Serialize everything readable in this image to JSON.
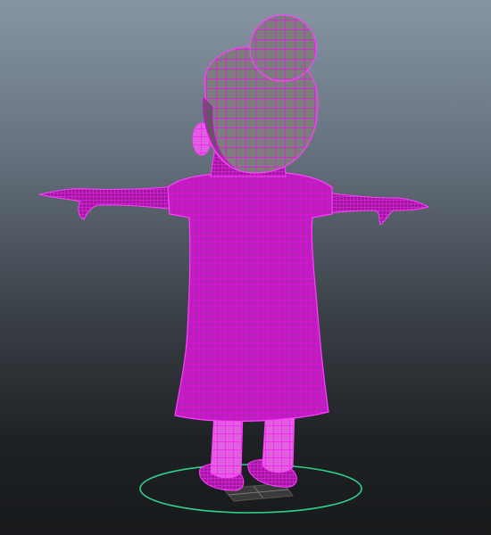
{
  "viewport": {
    "background_top": "#8795a3",
    "background_bottom": "#17191b"
  },
  "model": {
    "description_icon": "character-mesh-icon",
    "shaded_color": "#828282",
    "shaded_dark": "#5a5a5a",
    "wireframe_color": "#ff00ff",
    "pose": "T-pose",
    "view": "back"
  },
  "manipulator": {
    "ring_color": "#2fd08a",
    "grid_color": "#555555"
  }
}
